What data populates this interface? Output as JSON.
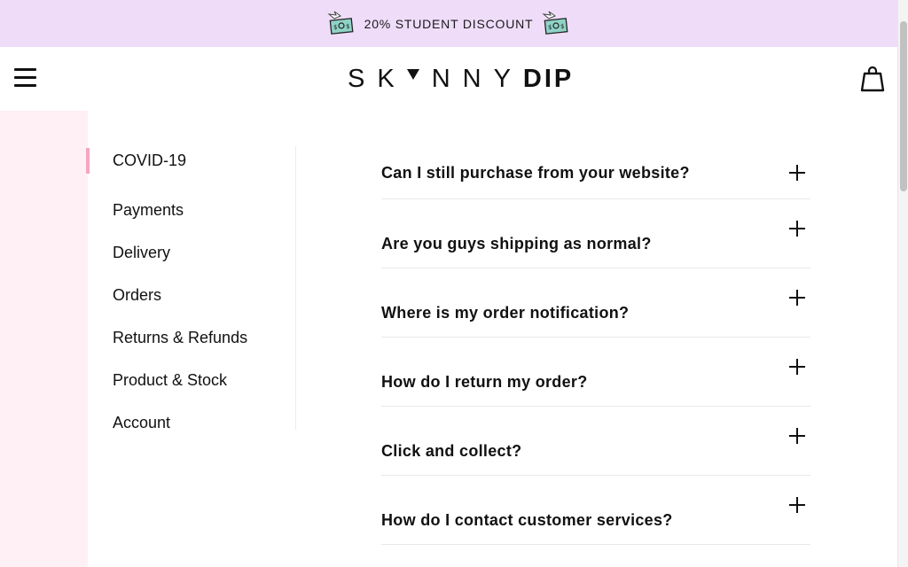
{
  "promo": {
    "text": "20% STUDENT DISCOUNT",
    "icon_left": "flying-money-icon",
    "icon_right": "flying-money-icon",
    "background": "#efdcf9"
  },
  "header": {
    "menu_icon": "hamburger-menu-icon",
    "logo_light": "SK",
    "logo_light_rest": "NNY",
    "logo_bold": "DIP",
    "cart_icon": "shopping-bag-icon"
  },
  "nav": {
    "accent": "#f4a7c0",
    "active_index": 0,
    "items": [
      {
        "label": "COVID-19"
      },
      {
        "label": "Payments"
      },
      {
        "label": "Delivery"
      },
      {
        "label": "Orders"
      },
      {
        "label": "Returns & Refunds"
      },
      {
        "label": "Product & Stock"
      },
      {
        "label": "Account"
      }
    ]
  },
  "faq": {
    "expand_icon": "plus-icon",
    "items": [
      {
        "question": "Can I still purchase from your website?"
      },
      {
        "question": "Are you guys shipping as normal?"
      },
      {
        "question": "Where is my order notification?"
      },
      {
        "question": "How do I return my order?"
      },
      {
        "question": "Click and collect?"
      },
      {
        "question": "How do I contact customer services?"
      }
    ]
  }
}
